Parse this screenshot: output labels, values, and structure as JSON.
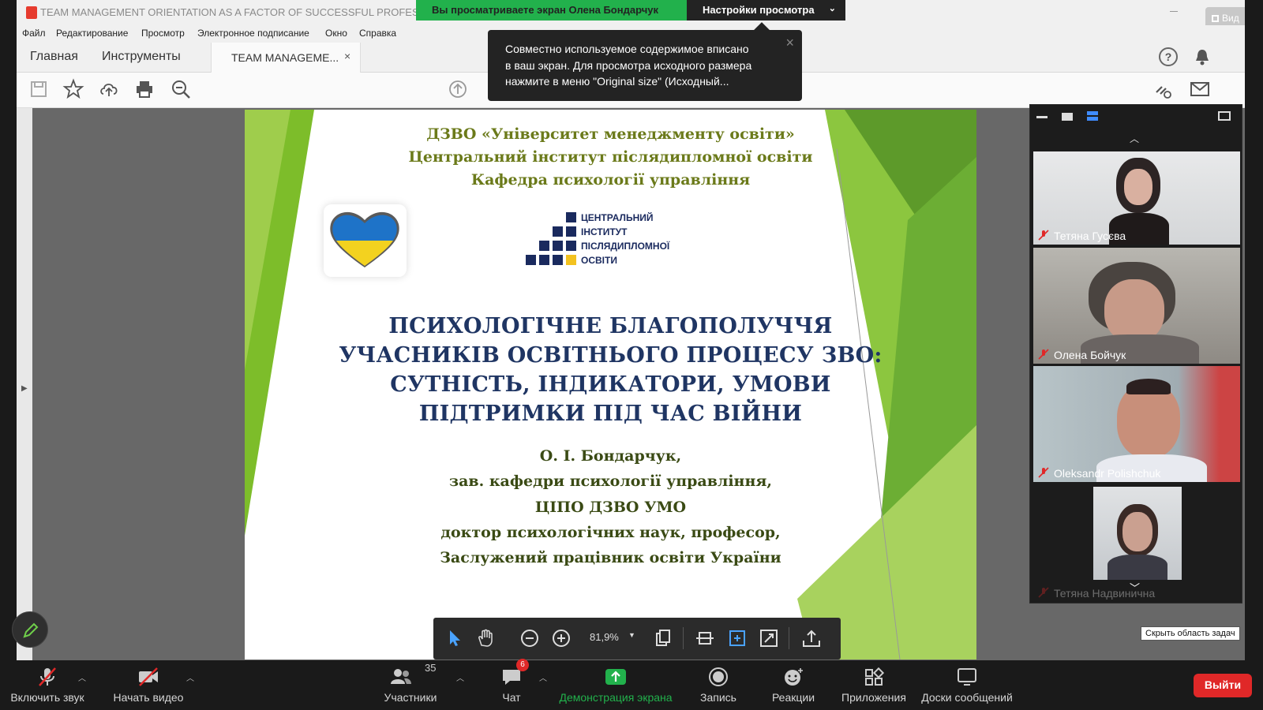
{
  "share_banner": {
    "viewing_text": "Вы просматриваете экран Олена Бондарчук",
    "view_settings_label": "Настройки просмотра"
  },
  "tooltip": {
    "lines": [
      "Совместно используемое содержимое вписано",
      "в ваш экран. Для просмотра исходного размера",
      "нажмите в  меню \"Original size\" (Исходный..."
    ]
  },
  "acrobat": {
    "window_title": "TEAM MANAGEMENT ORIENTATION AS A FACTOR OF SUCCESSFUL PROFESSIONAL L",
    "vid_label": "Вид",
    "menu": [
      "Файл",
      "Редактирование",
      "Просмотр",
      "Электронное подписание",
      "Окно",
      "Справка"
    ],
    "tabs": {
      "home": "Главная",
      "tools": "Инструменты",
      "document": "TEAM MANAGEME...",
      "close": "×"
    }
  },
  "slide": {
    "header_lines": [
      "ДЗВО  «Університет менеджменту освіти»",
      "Центральний інститут післядипломної освіти",
      "Кафедра психології управління"
    ],
    "logo_lines": [
      "ЦЕНТРАЛЬНИЙ",
      "ІНСТИТУТ",
      "ПІСЛЯДИПЛОМНОЇ",
      "ОСВІТИ"
    ],
    "title_lines": [
      "ПСИХОЛОГІЧНЕ БЛАГОПОЛУЧЧЯ",
      "УЧАСНИКІВ ОСВІТНЬОГО ПРОЦЕСУ ЗВО:",
      "СУТНІСТЬ, ІНДИКАТОРИ, УМОВИ",
      "ПІДТРИМКИ ПІД ЧАС ВІЙНИ"
    ],
    "author_lines": [
      "О. І. Бондарчук,",
      "зав. кафедри психології управління,",
      "ЦІПО ДЗВО УМО",
      "доктор психологічних наук, професор,",
      "Заслужений працівник освіти України"
    ]
  },
  "pdf_toolbar": {
    "zoom": "81,9%"
  },
  "participants_panel": {
    "tiles": [
      {
        "name": "Тетяна Гусєва"
      },
      {
        "name": "Олена Бойчук"
      },
      {
        "name": "Oleksandr Polishchuk"
      },
      {
        "name": "Тетяна Надвинична"
      }
    ]
  },
  "hide_taskbar_tip": "Скрыть область задач",
  "zoom_bar": {
    "unmute": "Включить звук",
    "start_video": "Начать видео",
    "participants": "Участники",
    "participants_count": "35",
    "chat": "Чат",
    "chat_badge": "6",
    "share_screen": "Демонстрация экрана",
    "record": "Запись",
    "reactions": "Реакции",
    "apps": "Приложения",
    "whiteboards": "Доски сообщений",
    "leave": "Выйти"
  },
  "colors": {
    "share_green": "#22b14c",
    "slide_green": "#7dbd2a",
    "title_navy": "#1f3563",
    "header_olive": "#6b7a1a",
    "leave_red": "#e02828"
  }
}
